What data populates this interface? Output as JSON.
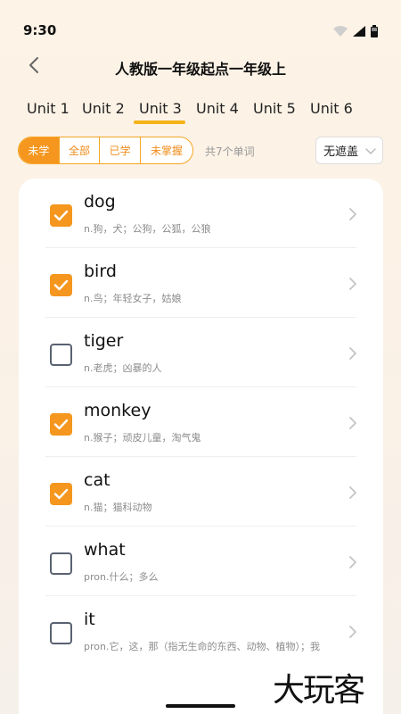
{
  "status": {
    "time": "9:30"
  },
  "nav": {
    "title": "人教版一年级起点一年级上"
  },
  "units": [
    "Unit 1",
    "Unit 2",
    "Unit 3",
    "Unit 4",
    "Unit 5",
    "Unit 6"
  ],
  "active_unit": "Unit 3",
  "filters": {
    "options": [
      "未学",
      "全部",
      "已学",
      "未掌握"
    ],
    "active": "未学",
    "count_text": "共7个单词",
    "cover_select": "无遮盖"
  },
  "words": [
    {
      "word": "dog",
      "meaning": "n.狗，犬；公狗，公狐，公狼",
      "checked": true
    },
    {
      "word": "bird",
      "meaning": "n.鸟；年轻女子，姑娘",
      "checked": true
    },
    {
      "word": "tiger",
      "meaning": "n.老虎；凶暴的人",
      "checked": false
    },
    {
      "word": "monkey",
      "meaning": "n.猴子；顽皮儿童，淘气鬼",
      "checked": true
    },
    {
      "word": "cat",
      "meaning": "n.猫；猫科动物",
      "checked": true
    },
    {
      "word": "what",
      "meaning": "pron.什么；多么",
      "checked": false
    },
    {
      "word": "it",
      "meaning": "pron.它，这，那（指无生命的东西、动物、植物）；我",
      "checked": false
    }
  ],
  "watermark": "大玩客",
  "colors": {
    "accent": "#f5961e",
    "underline": "#f5b415"
  }
}
